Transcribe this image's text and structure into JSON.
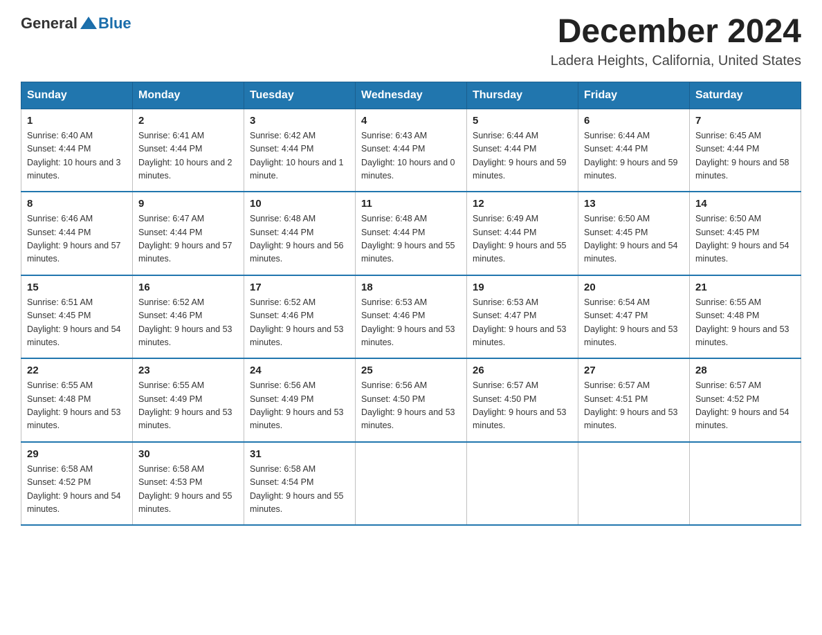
{
  "logo": {
    "general": "General",
    "blue": "Blue"
  },
  "title": "December 2024",
  "subtitle": "Ladera Heights, California, United States",
  "days_of_week": [
    "Sunday",
    "Monday",
    "Tuesday",
    "Wednesday",
    "Thursday",
    "Friday",
    "Saturday"
  ],
  "weeks": [
    [
      {
        "day": "1",
        "sunrise": "6:40 AM",
        "sunset": "4:44 PM",
        "daylight": "10 hours and 3 minutes."
      },
      {
        "day": "2",
        "sunrise": "6:41 AM",
        "sunset": "4:44 PM",
        "daylight": "10 hours and 2 minutes."
      },
      {
        "day": "3",
        "sunrise": "6:42 AM",
        "sunset": "4:44 PM",
        "daylight": "10 hours and 1 minute."
      },
      {
        "day": "4",
        "sunrise": "6:43 AM",
        "sunset": "4:44 PM",
        "daylight": "10 hours and 0 minutes."
      },
      {
        "day": "5",
        "sunrise": "6:44 AM",
        "sunset": "4:44 PM",
        "daylight": "9 hours and 59 minutes."
      },
      {
        "day": "6",
        "sunrise": "6:44 AM",
        "sunset": "4:44 PM",
        "daylight": "9 hours and 59 minutes."
      },
      {
        "day": "7",
        "sunrise": "6:45 AM",
        "sunset": "4:44 PM",
        "daylight": "9 hours and 58 minutes."
      }
    ],
    [
      {
        "day": "8",
        "sunrise": "6:46 AM",
        "sunset": "4:44 PM",
        "daylight": "9 hours and 57 minutes."
      },
      {
        "day": "9",
        "sunrise": "6:47 AM",
        "sunset": "4:44 PM",
        "daylight": "9 hours and 57 minutes."
      },
      {
        "day": "10",
        "sunrise": "6:48 AM",
        "sunset": "4:44 PM",
        "daylight": "9 hours and 56 minutes."
      },
      {
        "day": "11",
        "sunrise": "6:48 AM",
        "sunset": "4:44 PM",
        "daylight": "9 hours and 55 minutes."
      },
      {
        "day": "12",
        "sunrise": "6:49 AM",
        "sunset": "4:44 PM",
        "daylight": "9 hours and 55 minutes."
      },
      {
        "day": "13",
        "sunrise": "6:50 AM",
        "sunset": "4:45 PM",
        "daylight": "9 hours and 54 minutes."
      },
      {
        "day": "14",
        "sunrise": "6:50 AM",
        "sunset": "4:45 PM",
        "daylight": "9 hours and 54 minutes."
      }
    ],
    [
      {
        "day": "15",
        "sunrise": "6:51 AM",
        "sunset": "4:45 PM",
        "daylight": "9 hours and 54 minutes."
      },
      {
        "day": "16",
        "sunrise": "6:52 AM",
        "sunset": "4:46 PM",
        "daylight": "9 hours and 53 minutes."
      },
      {
        "day": "17",
        "sunrise": "6:52 AM",
        "sunset": "4:46 PM",
        "daylight": "9 hours and 53 minutes."
      },
      {
        "day": "18",
        "sunrise": "6:53 AM",
        "sunset": "4:46 PM",
        "daylight": "9 hours and 53 minutes."
      },
      {
        "day": "19",
        "sunrise": "6:53 AM",
        "sunset": "4:47 PM",
        "daylight": "9 hours and 53 minutes."
      },
      {
        "day": "20",
        "sunrise": "6:54 AM",
        "sunset": "4:47 PM",
        "daylight": "9 hours and 53 minutes."
      },
      {
        "day": "21",
        "sunrise": "6:55 AM",
        "sunset": "4:48 PM",
        "daylight": "9 hours and 53 minutes."
      }
    ],
    [
      {
        "day": "22",
        "sunrise": "6:55 AM",
        "sunset": "4:48 PM",
        "daylight": "9 hours and 53 minutes."
      },
      {
        "day": "23",
        "sunrise": "6:55 AM",
        "sunset": "4:49 PM",
        "daylight": "9 hours and 53 minutes."
      },
      {
        "day": "24",
        "sunrise": "6:56 AM",
        "sunset": "4:49 PM",
        "daylight": "9 hours and 53 minutes."
      },
      {
        "day": "25",
        "sunrise": "6:56 AM",
        "sunset": "4:50 PM",
        "daylight": "9 hours and 53 minutes."
      },
      {
        "day": "26",
        "sunrise": "6:57 AM",
        "sunset": "4:50 PM",
        "daylight": "9 hours and 53 minutes."
      },
      {
        "day": "27",
        "sunrise": "6:57 AM",
        "sunset": "4:51 PM",
        "daylight": "9 hours and 53 minutes."
      },
      {
        "day": "28",
        "sunrise": "6:57 AM",
        "sunset": "4:52 PM",
        "daylight": "9 hours and 54 minutes."
      }
    ],
    [
      {
        "day": "29",
        "sunrise": "6:58 AM",
        "sunset": "4:52 PM",
        "daylight": "9 hours and 54 minutes."
      },
      {
        "day": "30",
        "sunrise": "6:58 AM",
        "sunset": "4:53 PM",
        "daylight": "9 hours and 55 minutes."
      },
      {
        "day": "31",
        "sunrise": "6:58 AM",
        "sunset": "4:54 PM",
        "daylight": "9 hours and 55 minutes."
      },
      null,
      null,
      null,
      null
    ]
  ]
}
